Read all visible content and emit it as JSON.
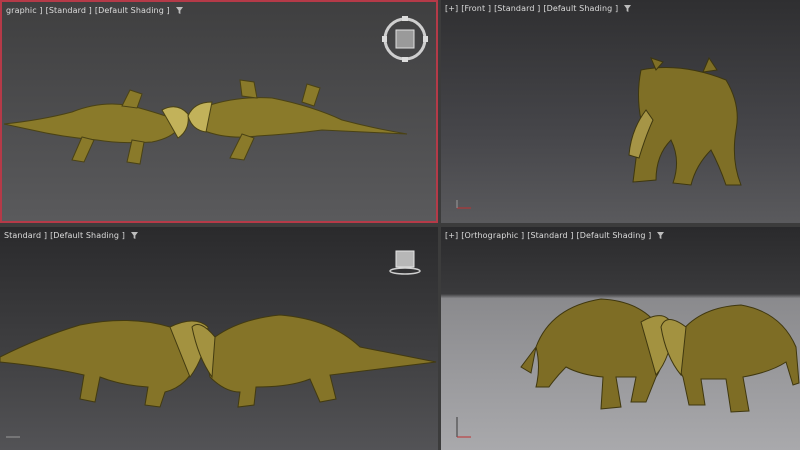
{
  "viewports": {
    "top_left": {
      "label_parts": [
        "graphic ]",
        "[Standard ]",
        "[Default Shading ]"
      ]
    },
    "top_right": {
      "label_parts": [
        "[+]",
        "[Front ]",
        "[Standard ]",
        "[Default Shading ]"
      ]
    },
    "bottom_left": {
      "label_parts": [
        "Standard ]",
        "[Default Shading ]"
      ]
    },
    "bottom_right": {
      "label_parts": [
        "[+]",
        "[Orthographic ]",
        "[Standard ]",
        "[Default Shading ]"
      ]
    }
  },
  "icons": {
    "filter": "filter-icon",
    "viewcube": "viewcube-icon",
    "axis": "axis-gizmo-icon"
  },
  "colors": {
    "active_border": "#b53a48",
    "dino_body": "#8a7a2a",
    "dino_dark": "#4a4214",
    "dino_light": "#c2b25a"
  }
}
